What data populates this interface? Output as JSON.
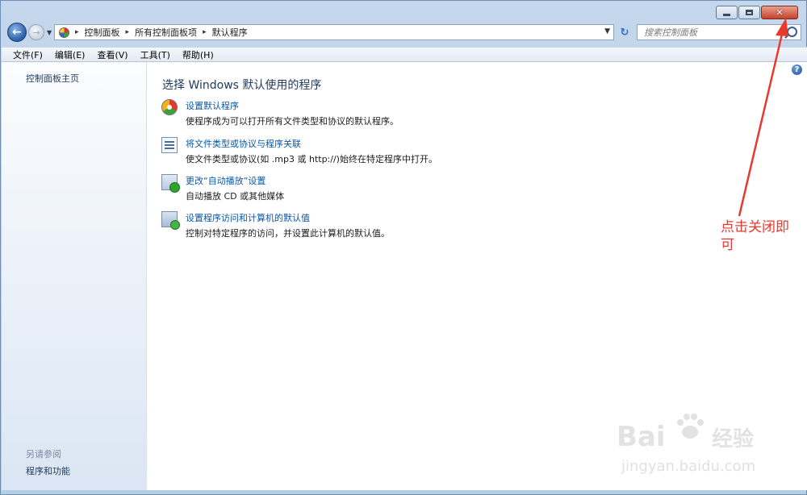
{
  "window": {
    "minimize_label": "—",
    "maximize_label": "□",
    "close_label": "✕"
  },
  "navbar": {
    "breadcrumbs": [
      "控制面板",
      "所有控制面板项",
      "默认程序"
    ],
    "breadcrumb_separator": "▸",
    "search_placeholder": "搜索控制面板"
  },
  "menubar": {
    "items": [
      "文件(F)",
      "编辑(E)",
      "查看(V)",
      "工具(T)",
      "帮助(H)"
    ]
  },
  "sidebar": {
    "home_label": "控制面板主页",
    "see_also_label": "另请参阅",
    "links": [
      "程序和功能"
    ]
  },
  "main": {
    "title": "选择 Windows 默认使用的程序",
    "options": [
      {
        "icon": "default-programs-icon",
        "link": "设置默认程序",
        "description": "使程序成为可以打开所有文件类型和协议的默认程序。"
      },
      {
        "icon": "file-association-icon",
        "link": "将文件类型或协议与程序关联",
        "description": "使文件类型或协议(如 .mp3 或 http://)始终在特定程序中打开。"
      },
      {
        "icon": "autoplay-icon",
        "link": "更改“自动播放”设置",
        "description": "自动播放 CD 或其他媒体"
      },
      {
        "icon": "program-access-icon",
        "link": "设置程序访问和计算机的默认值",
        "description": "控制对特定程序的访问，并设置此计算机的默认值。"
      }
    ]
  },
  "annotation": {
    "text": "点击关闭即可",
    "color": "#e8392f"
  },
  "watermark": {
    "logo_text": "Bai",
    "logo_text_2": "经验",
    "url": "jingyan.baidu.com"
  }
}
